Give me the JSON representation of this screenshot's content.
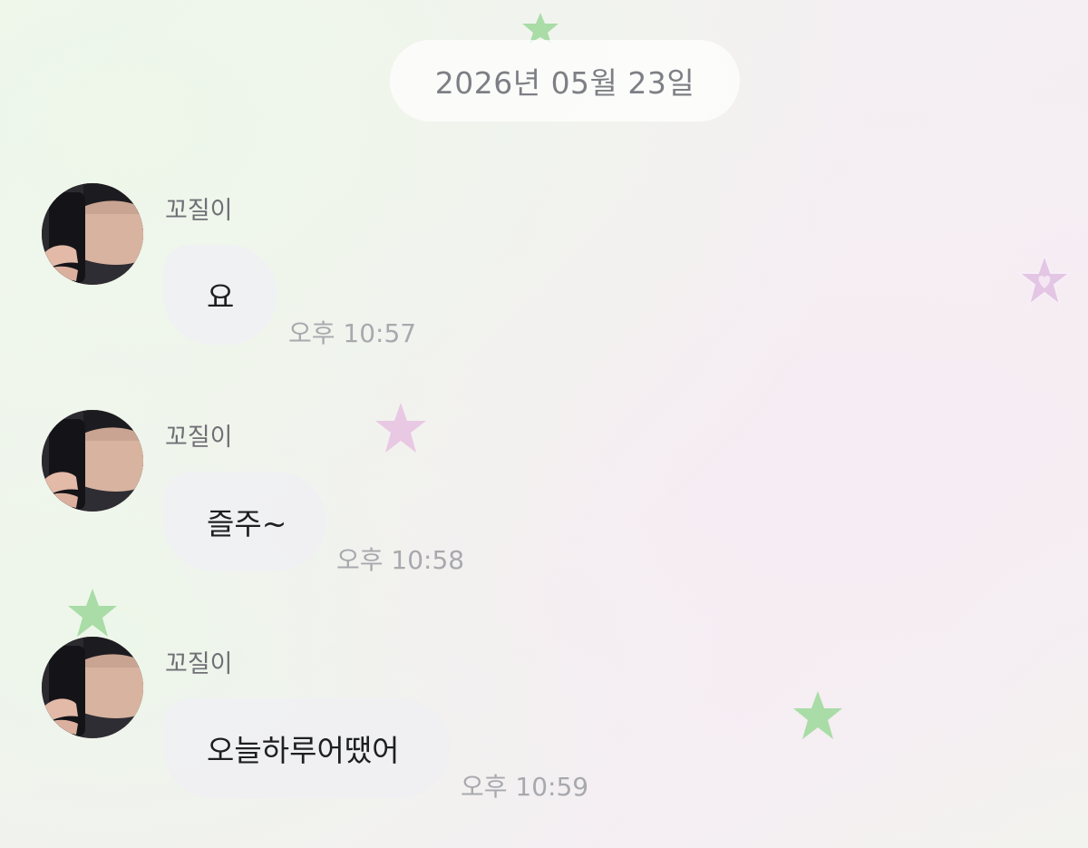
{
  "date_divider": "2026년 05월 23일",
  "colors": {
    "green_star": "#a9dca6",
    "pink_star": "#e9c8e4",
    "bubble": "#f0f0f3",
    "time_text": "#a8a9ae"
  },
  "messages": [
    {
      "sender": "꼬질이",
      "text": "요",
      "time": "오후 10:57",
      "avatar": "profile-photo"
    },
    {
      "sender": "꼬질이",
      "text": "즐주~",
      "time": "오후 10:58",
      "avatar": "profile-photo"
    },
    {
      "sender": "꼬질이",
      "text": "오늘하루어땠어",
      "time": "오후 10:59",
      "avatar": "profile-photo"
    }
  ]
}
